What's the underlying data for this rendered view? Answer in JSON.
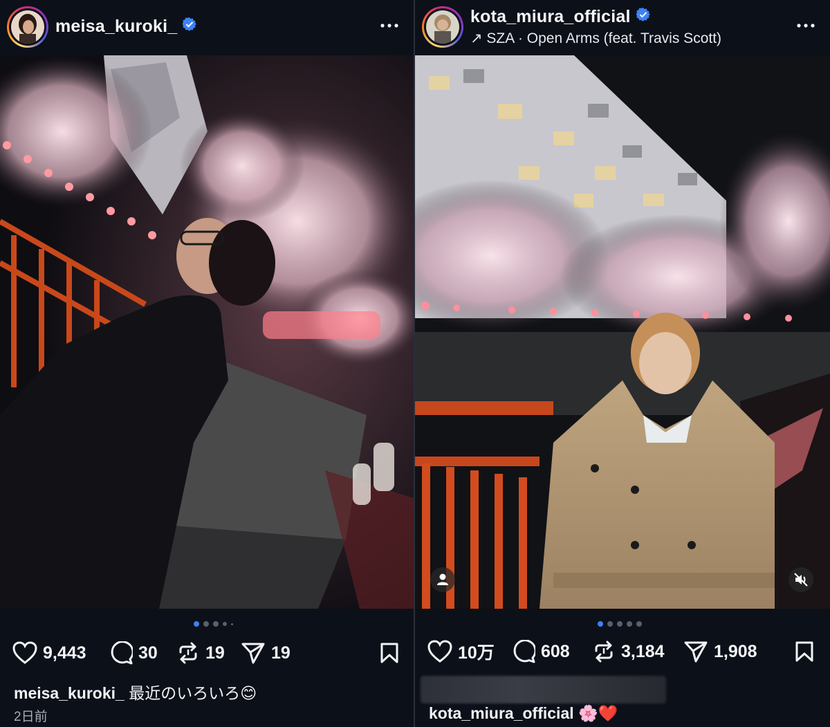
{
  "left_post": {
    "username": "meisa_kuroki_",
    "verified": true,
    "more_label": "•••",
    "likes": "9,443",
    "comments": "30",
    "reposts": "19",
    "shares": "19",
    "caption_user": "meisa_kuroki_",
    "caption_text": "最近のいろいろ😊",
    "timestamp": "2日前",
    "carousel_total": 5,
    "carousel_index": 1
  },
  "right_post": {
    "username": "kota_miura_official",
    "verified": true,
    "music": "↗ SZA · Open Arms (feat. Travis Scott)",
    "more_label": "•••",
    "likes": "10万",
    "comments": "608",
    "reposts": "3,184",
    "shares": "1,908",
    "caption_user": "kota_miura_official",
    "caption_text": "🌸❤️",
    "carousel_total": 5,
    "carousel_index": 1
  },
  "icons": [
    "verified-badge-icon",
    "more-icon",
    "heart-icon",
    "comment-icon",
    "repost-icon",
    "share-icon",
    "bookmark-icon",
    "user-tag-icon",
    "mute-icon"
  ],
  "colors": {
    "background": "#0c1019",
    "verified": "#3d82f6",
    "active_dot": "#3d82f6"
  }
}
